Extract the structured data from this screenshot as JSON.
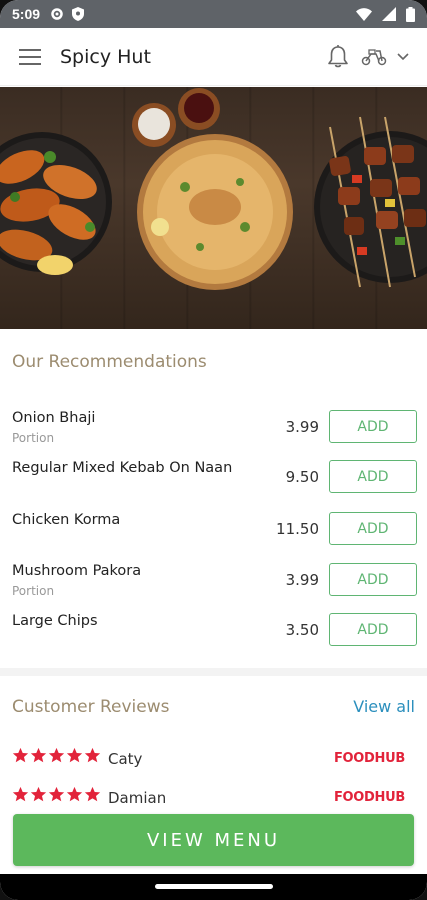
{
  "status": {
    "time": "5:09"
  },
  "app": {
    "title": "Spicy Hut"
  },
  "recommendations": {
    "title": "Our Recommendations",
    "items": [
      {
        "name": "Onion Bhaji",
        "sub": "Portion",
        "price": "3.99",
        "action": "ADD"
      },
      {
        "name": "Regular Mixed Kebab On Naan",
        "sub": "",
        "price": "9.50",
        "action": "ADD"
      },
      {
        "name": "Chicken Korma",
        "sub": "",
        "price": "11.50",
        "action": "ADD"
      },
      {
        "name": "Mushroom Pakora",
        "sub": "Portion",
        "price": "3.99",
        "action": "ADD"
      },
      {
        "name": "Large Chips",
        "sub": "",
        "price": "3.50",
        "action": "ADD"
      }
    ]
  },
  "reviews": {
    "title": "Customer Reviews",
    "view_all": "View all",
    "items": [
      {
        "name": "Caty",
        "rating": 5,
        "source": "FOODHUB"
      },
      {
        "name": "Damian",
        "rating": 5,
        "source": "FOODHUB"
      }
    ]
  },
  "cta": {
    "label": "VIEW MENU"
  },
  "colors": {
    "accent_green": "#5cb85c",
    "link_blue": "#2b8fbd",
    "star_red": "#e2233a",
    "section_tan": "#9c8c70"
  }
}
